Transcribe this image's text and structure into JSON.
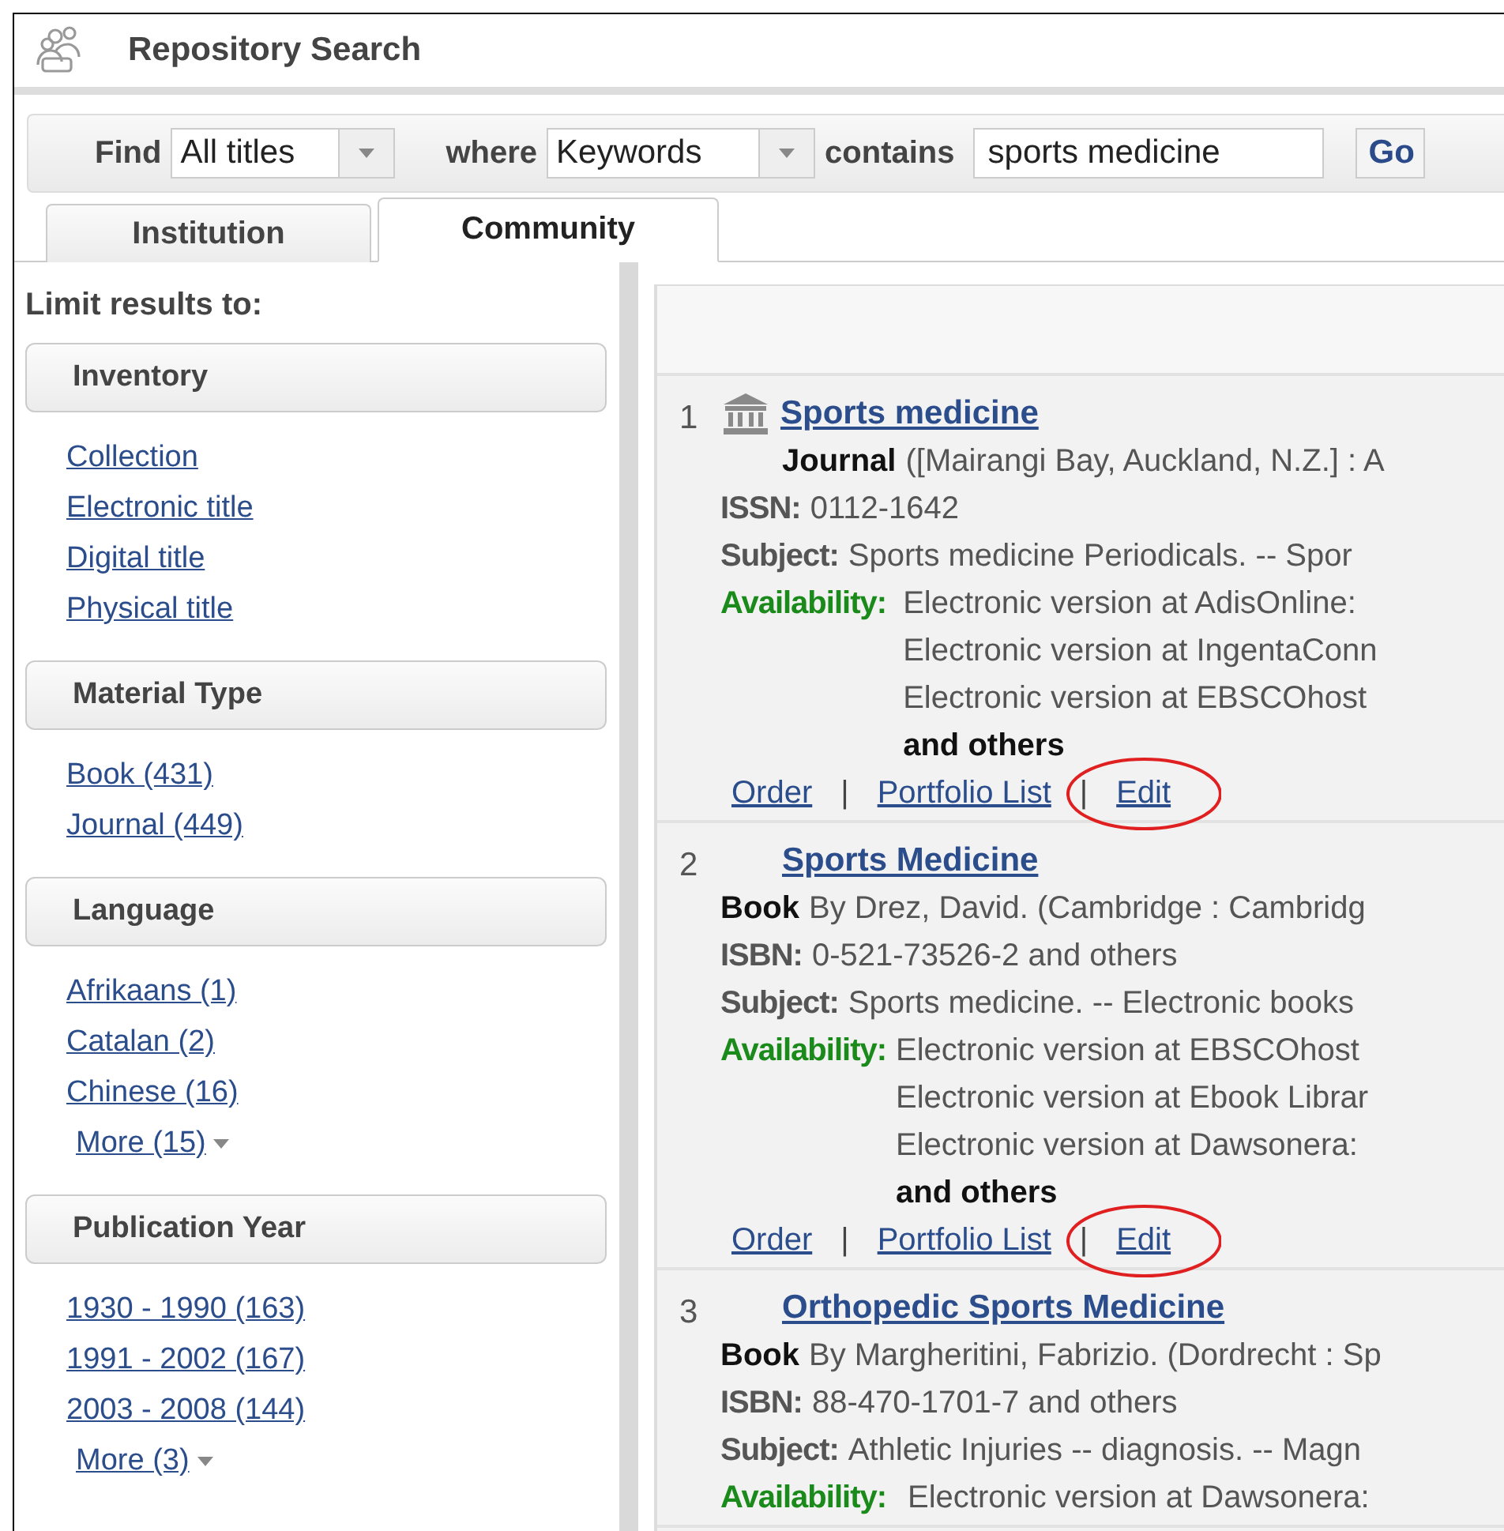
{
  "header": {
    "title": "Repository Search"
  },
  "search": {
    "find_label": "Find",
    "find_value": "All titles",
    "where_label": "where",
    "where_value": "Keywords",
    "contains_label": "contains",
    "query": "sports medicine",
    "go": "Go"
  },
  "tabs": [
    {
      "label": "Institution",
      "selected": false
    },
    {
      "label": "Community",
      "selected": true
    }
  ],
  "sidebar": {
    "heading": "Limit results to:",
    "groups": [
      {
        "title": "Inventory",
        "links": [
          "Collection",
          "Electronic title",
          "Digital title",
          "Physical title"
        ]
      },
      {
        "title": "Material Type",
        "links": [
          "Book (431)",
          "Journal (449)"
        ]
      },
      {
        "title": "Language",
        "links": [
          "Afrikaans (1)",
          "Catalan (2)",
          "Chinese (16)"
        ],
        "more": "More (15)"
      },
      {
        "title": "Publication Year",
        "links": [
          "1930 - 1990 (163)",
          "1991 - 2002 (167)",
          "2003 - 2008 (144)"
        ],
        "more": "More (3)"
      }
    ]
  },
  "results": [
    {
      "kind": "institutional",
      "number": "1",
      "title": "Sports medicine",
      "type": "Journal",
      "details": "([Mairangi Bay, Auckland, N.Z.] : A",
      "fields": [
        {
          "label": "ISSN:",
          "value": "0112-1642"
        },
        {
          "label": "Subject:",
          "value": "Sports medicine Periodicals. -- Spor"
        }
      ],
      "availability": {
        "label": "Availability:",
        "lines": [
          "Electronic version at AdisOnline:",
          "Electronic version at IngentaConn",
          "Electronic version at EBSCOhost"
        ],
        "more": "and others"
      },
      "separator": "|",
      "actions": [
        {
          "label": "Order",
          "circled": false
        },
        {
          "label": "Portfolio List",
          "circled": false
        },
        {
          "label": "Edit",
          "circled": true
        }
      ]
    },
    {
      "kind": "standard",
      "number": "2",
      "title": "Sports Medicine",
      "type": "Book",
      "details": "By Drez, David. (Cambridge : Cambridg",
      "fields": [
        {
          "label": "ISBN:",
          "value": "0-521-73526-2 and others"
        },
        {
          "label": "Subject:",
          "value": "Sports medicine. -- Electronic books"
        }
      ],
      "availability": {
        "label": "Availability:",
        "lines": [
          "Electronic version at EBSCOhost",
          "Electronic version at Ebook Librar",
          "Electronic version at Dawsonera:"
        ],
        "more": "and others"
      },
      "separator": "|",
      "actions": [
        {
          "label": "Order",
          "circled": false
        },
        {
          "label": "Portfolio List",
          "circled": false
        },
        {
          "label": "Edit",
          "circled": true
        }
      ]
    },
    {
      "kind": "standard",
      "number": "3",
      "title": "Orthopedic Sports Medicine",
      "type": "Book",
      "details": "By Margheritini, Fabrizio. (Dordrecht : Sp",
      "fields": [
        {
          "label": "ISBN:",
          "value": "88-470-1701-7 and others"
        },
        {
          "label": "Subject:",
          "value": "Athletic Injuries -- diagnosis. -- Magn"
        }
      ],
      "availability": {
        "label": "Availability:",
        "lines": [
          "Electronic version at Dawsonera:"
        ]
      }
    }
  ]
}
